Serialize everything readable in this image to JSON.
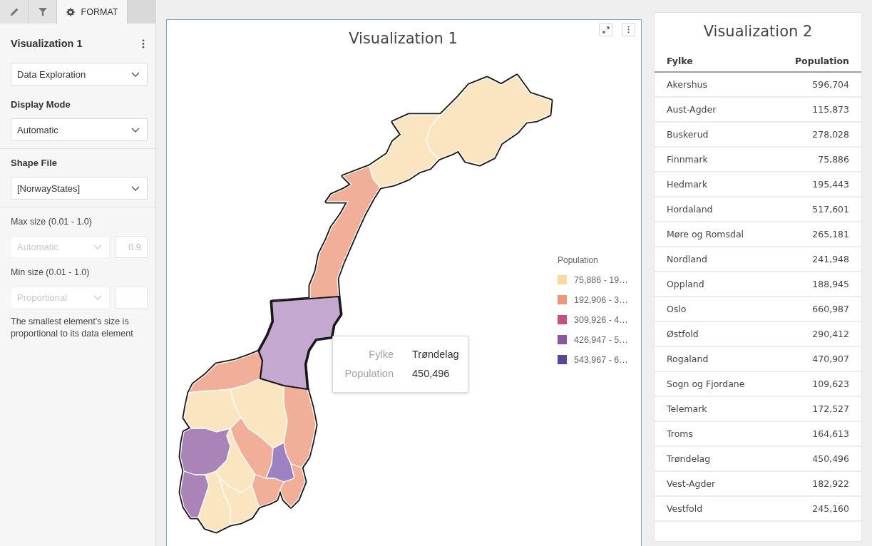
{
  "tabs": [
    {
      "selected": false
    },
    {
      "selected": false
    },
    {
      "label": "FORMAT",
      "selected": true
    }
  ],
  "format_panel": {
    "title": "Visualization 1",
    "view_select": {
      "value": "Data Exploration",
      "disabled": false
    },
    "display_mode": {
      "label": "Display Mode",
      "select": {
        "value": "Automatic",
        "disabled": false
      }
    },
    "shape_file": {
      "label": "Shape File",
      "select": {
        "value": "[NorwayStates]",
        "disabled": false
      }
    },
    "max_size": {
      "label": "Max size (0.01 - 1.0)",
      "select": {
        "value": "Automatic",
        "disabled": true
      },
      "input": {
        "value": "0.9",
        "disabled": true
      }
    },
    "min_size": {
      "label": "Min size (0.01 - 1.0)",
      "select": {
        "value": "Proportional",
        "disabled": true
      },
      "input": {
        "disabled": true
      }
    },
    "note": "The smallest element's size is proportional to its data element"
  },
  "map_view": {
    "title": "Visualization 1",
    "selected": true,
    "legend": {
      "title": "Population",
      "items": [
        {
          "label": "75,886 - 19…",
          "color": "#f6dc9c"
        },
        {
          "label": "192,906 - 3…",
          "color": "#ee9678"
        },
        {
          "label": "309,926 - 4…",
          "color": "#c9507a"
        },
        {
          "label": "426,947 - 5…",
          "color": "#8b56a4"
        },
        {
          "label": "543,967 - 6…",
          "color": "#5b4599"
        }
      ]
    },
    "tooltip": {
      "rows": [
        {
          "label": "Fylke",
          "value": "Trøndelag"
        },
        {
          "label": "Population",
          "value": "450,496"
        }
      ]
    }
  },
  "table_view": {
    "title": "Visualization 2",
    "selected": false,
    "columns": [
      "Fylke",
      "Population"
    ],
    "rows": [
      [
        "Akershus",
        "596,704"
      ],
      [
        "Aust-Agder",
        "115,873"
      ],
      [
        "Buskerud",
        "278,028"
      ],
      [
        "Finnmark",
        "75,886"
      ],
      [
        "Hedmark",
        "195,443"
      ],
      [
        "Hordaland",
        "517,601"
      ],
      [
        "Møre og Romsdal",
        "265,181"
      ],
      [
        "Nordland",
        "241,948"
      ],
      [
        "Oppland",
        "188,945"
      ],
      [
        "Oslo",
        "660,987"
      ],
      [
        "Østfold",
        "290,412"
      ],
      [
        "Rogaland",
        "470,907"
      ],
      [
        "Sogn og Fjordane",
        "109,623"
      ],
      [
        "Telemark",
        "172,527"
      ],
      [
        "Troms",
        "164,613"
      ],
      [
        "Trøndelag",
        "450,496"
      ],
      [
        "Vest-Agder",
        "182,922"
      ],
      [
        "Vestfold",
        "245,160"
      ]
    ]
  }
}
